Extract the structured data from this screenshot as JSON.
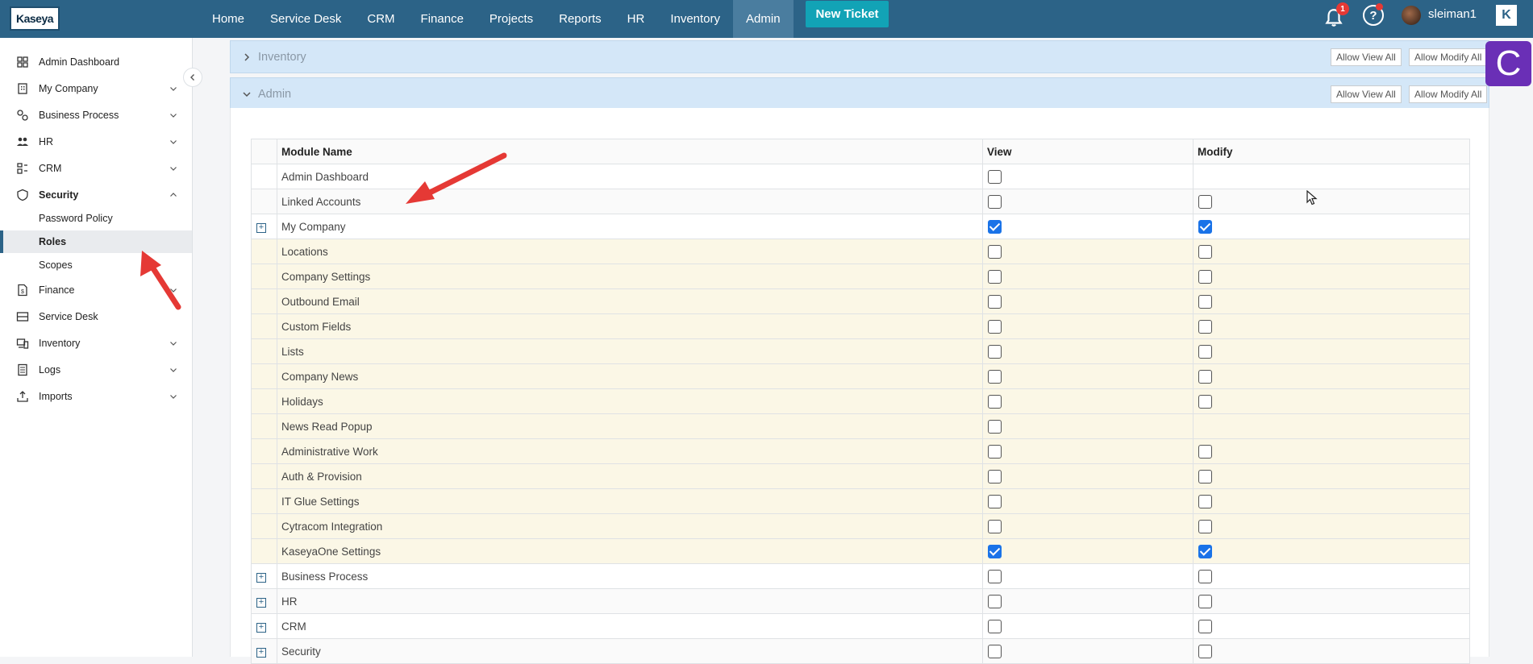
{
  "topbar": {
    "logo": "Kaseya",
    "nav": [
      "Home",
      "Service Desk",
      "CRM",
      "Finance",
      "Projects",
      "Reports",
      "HR",
      "Inventory",
      "Admin"
    ],
    "active_nav": "Admin",
    "new_ticket": "New Ticket",
    "notification_count": "1",
    "help_label": "?",
    "username": "sleiman1",
    "k_label": "K"
  },
  "sidebar": {
    "items": [
      {
        "label": "Admin Dashboard",
        "icon": "grid-icon"
      },
      {
        "label": "My Company",
        "icon": "building-icon"
      },
      {
        "label": "Business Process",
        "icon": "process-icon"
      },
      {
        "label": "HR",
        "icon": "people-icon"
      },
      {
        "label": "CRM",
        "icon": "crm-icon"
      },
      {
        "label": "Security",
        "icon": "shield-icon"
      },
      {
        "label": "Finance",
        "icon": "finance-icon"
      },
      {
        "label": "Service Desk",
        "icon": "service-desk-icon"
      },
      {
        "label": "Inventory",
        "icon": "inventory-icon"
      },
      {
        "label": "Logs",
        "icon": "logs-icon"
      },
      {
        "label": "Imports",
        "icon": "imports-icon"
      }
    ],
    "security_sub": [
      "Password Policy",
      "Roles",
      "Scopes"
    ],
    "active_sub": "Roles"
  },
  "sections": {
    "inventory": {
      "title": "Inventory",
      "allow_view": "Allow View All",
      "allow_modify": "Allow Modify All"
    },
    "admin": {
      "title": "Admin",
      "allow_view": "Allow View All",
      "allow_modify": "Allow Modify All"
    }
  },
  "c_badge": "C",
  "table": {
    "headers": [
      "Module Name",
      "View",
      "Modify"
    ],
    "rows": [
      {
        "name": "Admin Dashboard",
        "view": false,
        "modify": null,
        "expander": false,
        "sub": false
      },
      {
        "name": "Linked Accounts",
        "view": false,
        "modify": false,
        "expander": false,
        "sub": false
      },
      {
        "name": "My Company",
        "view": true,
        "modify": true,
        "expander": true,
        "sub": false
      },
      {
        "name": "Locations",
        "view": false,
        "modify": false,
        "expander": false,
        "sub": true
      },
      {
        "name": "Company Settings",
        "view": false,
        "modify": false,
        "expander": false,
        "sub": true
      },
      {
        "name": "Outbound Email",
        "view": false,
        "modify": false,
        "expander": false,
        "sub": true
      },
      {
        "name": "Custom Fields",
        "view": false,
        "modify": false,
        "expander": false,
        "sub": true
      },
      {
        "name": "Lists",
        "view": false,
        "modify": false,
        "expander": false,
        "sub": true
      },
      {
        "name": "Company News",
        "view": false,
        "modify": false,
        "expander": false,
        "sub": true
      },
      {
        "name": "Holidays",
        "view": false,
        "modify": false,
        "expander": false,
        "sub": true
      },
      {
        "name": "News Read Popup",
        "view": false,
        "modify": null,
        "expander": false,
        "sub": true
      },
      {
        "name": "Administrative Work",
        "view": false,
        "modify": false,
        "expander": false,
        "sub": true
      },
      {
        "name": "Auth & Provision",
        "view": false,
        "modify": false,
        "expander": false,
        "sub": true
      },
      {
        "name": "IT Glue Settings",
        "view": false,
        "modify": false,
        "expander": false,
        "sub": true
      },
      {
        "name": "Cytracom Integration",
        "view": false,
        "modify": false,
        "expander": false,
        "sub": true
      },
      {
        "name": "KaseyaOne Settings",
        "view": true,
        "modify": true,
        "expander": false,
        "sub": true
      },
      {
        "name": "Business Process",
        "view": false,
        "modify": false,
        "expander": true,
        "sub": false
      },
      {
        "name": "HR",
        "view": false,
        "modify": false,
        "expander": true,
        "sub": false
      },
      {
        "name": "CRM",
        "view": false,
        "modify": false,
        "expander": true,
        "sub": false
      },
      {
        "name": "Security",
        "view": false,
        "modify": false,
        "expander": true,
        "sub": false
      }
    ]
  },
  "colors": {
    "topbar": "#2c6387",
    "accent": "#12a3b6",
    "annotation": "#e53935",
    "c_badge": "#6a2fb6"
  }
}
